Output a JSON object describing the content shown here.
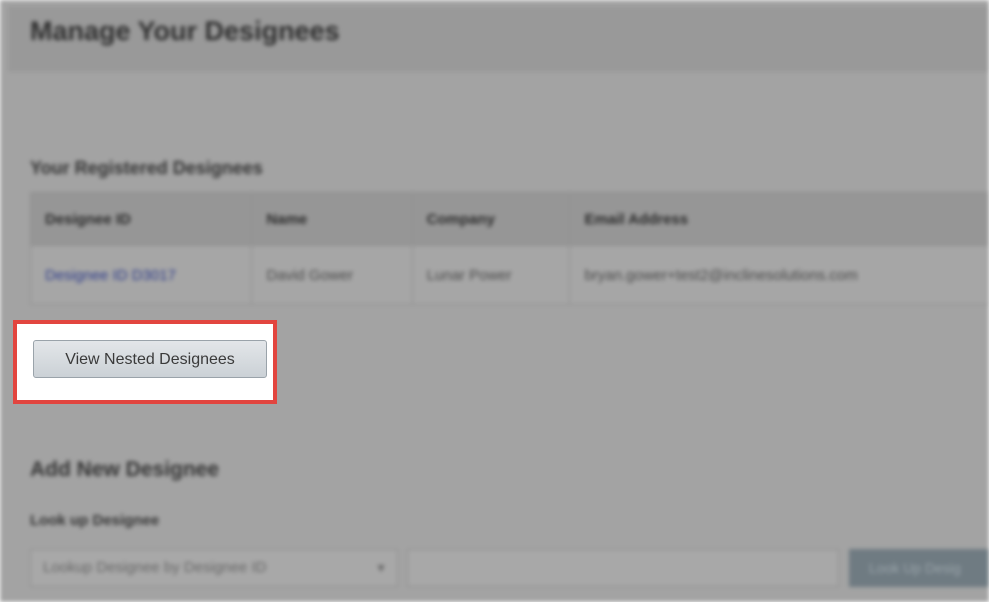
{
  "page": {
    "title": "Manage Your Designees"
  },
  "registered": {
    "section_title": "Your Registered Designees",
    "columns": [
      "Designee ID",
      "Name",
      "Company",
      "Email Address"
    ],
    "rows": [
      {
        "designee_id": "Designee ID D3017",
        "name": "David Gower",
        "company": "Lunar Power",
        "email": "bryan.gower+test2@inclinesolutions.com"
      }
    ],
    "view_nested_label": "View Nested Designees"
  },
  "add_new": {
    "section_title": "Add New Designee",
    "lookup_label": "Look up Designee",
    "lookup_select_value": "Lookup Designee by Designee ID",
    "lookup_input_value": "",
    "lookup_button_label": "Look Up Desig"
  },
  "colors": {
    "highlight_border": "#e2453f",
    "link": "#2d3b8a",
    "overlay": "#a3a3a3"
  }
}
